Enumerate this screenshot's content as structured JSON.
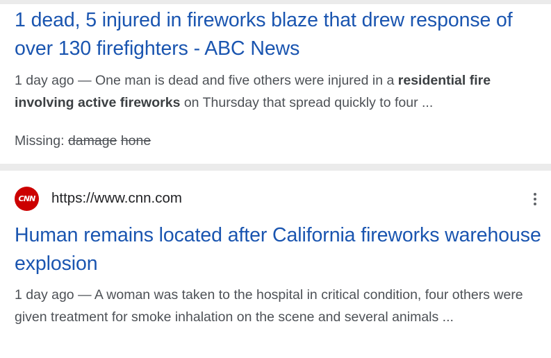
{
  "results": [
    {
      "title": "1 dead, 5 injured in fireworks blaze that drew response of over 130 firefighters - ABC News",
      "snippet_date": "1 day ago",
      "snippet_dash": " — ",
      "snippet_text_1": "One man is dead and five others were injured in a ",
      "snippet_bold_1": "residential fire involving active fireworks",
      "snippet_text_2": " on Thursday that spread quickly to four ...",
      "missing_label": "Missing: ",
      "missing_terms": [
        "damage",
        "hone"
      ]
    },
    {
      "favicon_text": "CNN",
      "favicon_color": "#cc0000",
      "source_url": "https://www.cnn.com",
      "more_icon": "more-vert-icon",
      "title": "Human remains located after California fireworks warehouse explosion",
      "snippet_date": "1 day ago",
      "snippet_dash": " — ",
      "snippet_text_1": "A woman was taken to the hospital in critical condition, four others were given treatment for smoke inhalation on the scene and several animals ..."
    }
  ],
  "colors": {
    "link": "#1a55b0",
    "snippet": "#4d5156",
    "divider": "#ebebeb"
  }
}
